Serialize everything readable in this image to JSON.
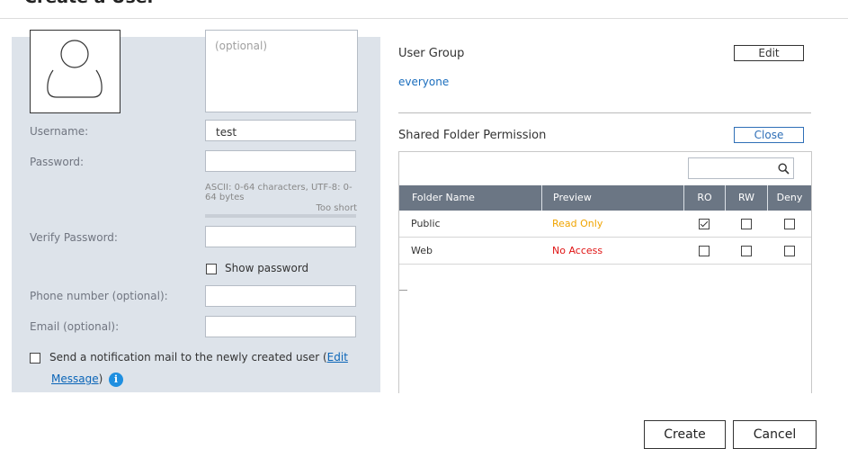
{
  "dialog": {
    "title": "Create a User"
  },
  "form": {
    "description_placeholder": "(optional)",
    "username_label": "Username:",
    "username_value": "test",
    "password_label": "Password:",
    "password_hint": "ASCII: 0-64 characters, UTF-8: 0-64 bytes",
    "password_strength": "Too short",
    "verify_label": "Verify Password:",
    "show_password_label": "Show password",
    "phone_label": "Phone number (optional):",
    "email_label": "Email (optional):",
    "notify_text": "Send a notification mail to the newly created user (",
    "notify_link_1": "Edit",
    "notify_link_2": "Message",
    "notify_close": ")",
    "info_glyph": "i"
  },
  "user_group": {
    "title": "User Group",
    "edit_label": "Edit",
    "group": "everyone"
  },
  "shared_folder": {
    "title": "Shared Folder Permission",
    "close_label": "Close",
    "columns": [
      "Folder Name",
      "Preview",
      "RO",
      "RW",
      "Deny"
    ],
    "rows": [
      {
        "name": "Public",
        "preview": "Read Only",
        "preview_color": "#f0a400",
        "ro": true,
        "rw": false,
        "deny": false
      },
      {
        "name": "Web",
        "preview": "No Access",
        "preview_color": "#e01414",
        "ro": false,
        "rw": false,
        "deny": false
      }
    ]
  },
  "footer": {
    "create_label": "Create",
    "cancel_label": "Cancel"
  },
  "icons": {
    "avatar": "user-silhouette-icon",
    "search": "search-icon",
    "info": "info-icon"
  }
}
